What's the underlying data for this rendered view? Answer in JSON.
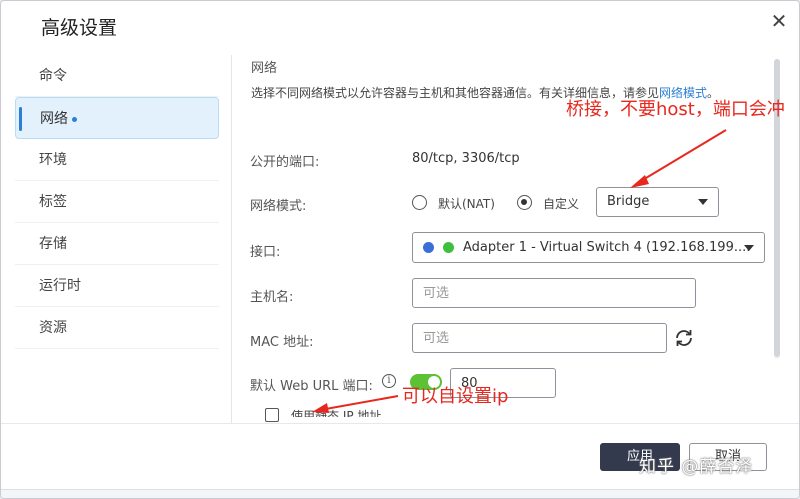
{
  "dialog": {
    "title": "高级设置",
    "close_glyph": "✕"
  },
  "sidebar": {
    "items": [
      {
        "label": "命令"
      },
      {
        "label": "网络",
        "active": true
      },
      {
        "label": "环境"
      },
      {
        "label": "标签"
      },
      {
        "label": "存储"
      },
      {
        "label": "运行时"
      },
      {
        "label": "资源"
      }
    ]
  },
  "network": {
    "section_title": "网络",
    "description": "选择不同网络模式以允许容器与主机和其他容器通信。有关详细信息，请参见",
    "description_link": "网络模式",
    "description_end": "。",
    "public_ports_label": "公开的端口:",
    "public_ports_value": "80/tcp, 3306/tcp",
    "network_mode_label": "网络模式:",
    "mode_default_label": "默认(NAT)",
    "mode_custom_label": "自定义",
    "selected_mode": "custom",
    "custom_network_value": "Bridge",
    "interface_label": "接口:",
    "interface_value": "Adapter 1 - Virtual Switch 4 (192.168.199....",
    "hostname_label": "主机名:",
    "hostname_placeholder": "可选",
    "mac_label": "MAC 地址:",
    "mac_placeholder": "可选",
    "web_url_port_label": "默认 Web URL 端口:",
    "web_url_port_enabled": true,
    "web_url_port_value": "80",
    "static_ip_label": "使用静态 IP 地址",
    "static_ip_checked": false
  },
  "footer": {
    "apply_label": "应用",
    "cancel_label": "取消"
  },
  "annotations": {
    "note1": "桥接，不要host，端口会冲",
    "note2": "可以自设置ip",
    "color": "#e8281e"
  },
  "watermark": "知乎 @薛否泽",
  "colors": {
    "accent": "#2b7fd4",
    "toggle_on": "#5bc236",
    "primary_button": "#333a4d"
  }
}
